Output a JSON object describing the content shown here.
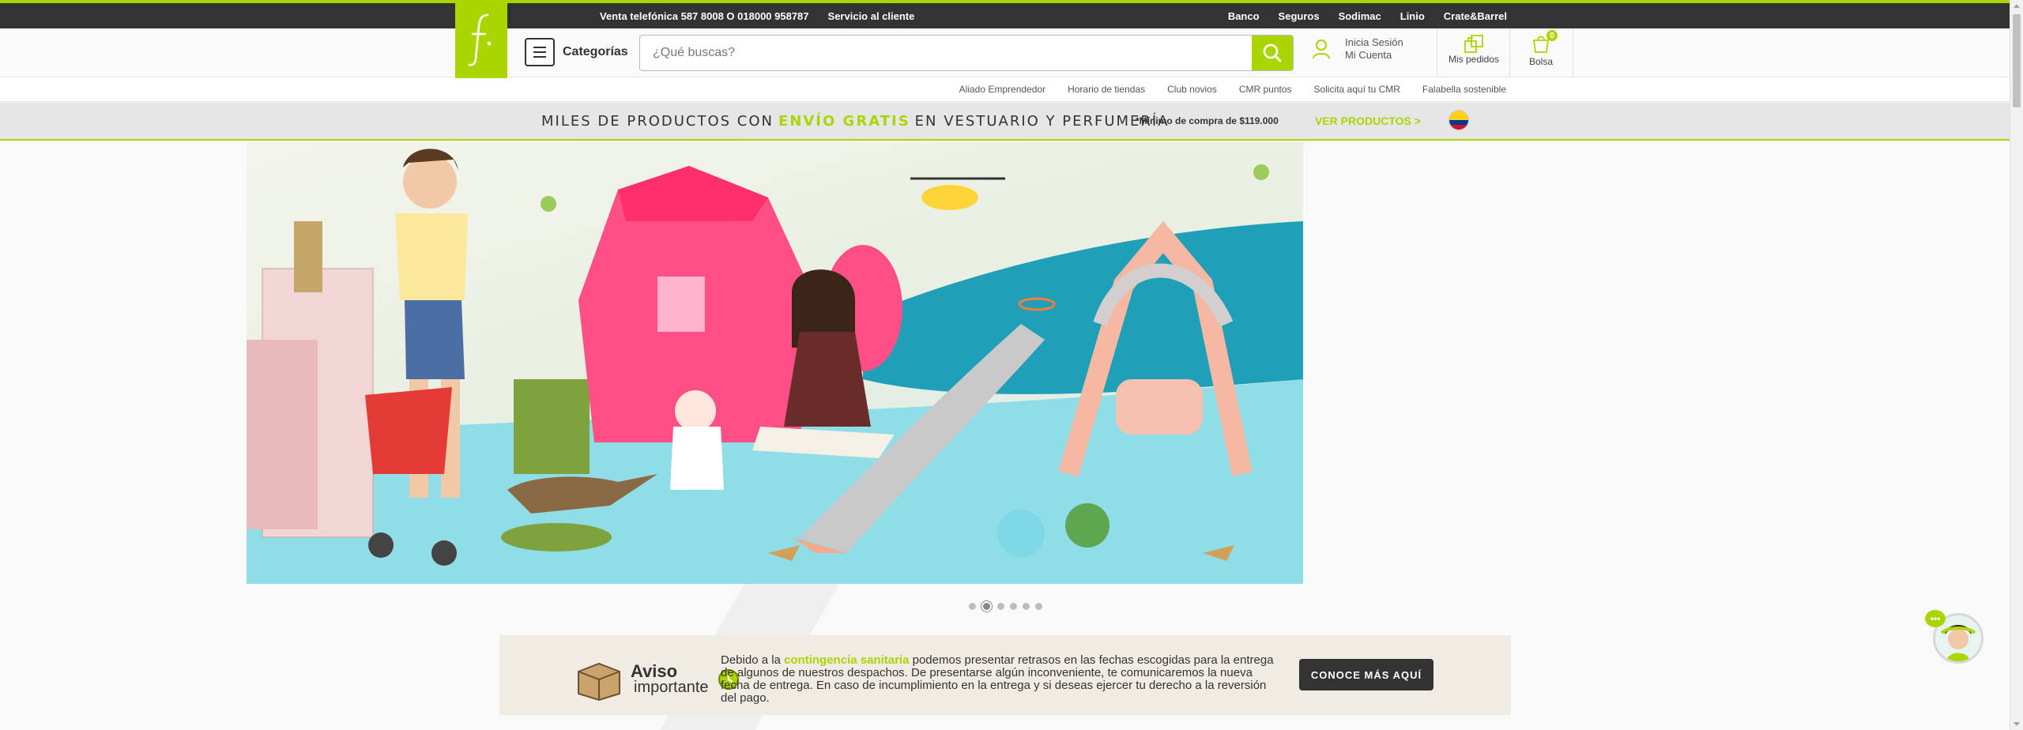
{
  "colors": {
    "brand": "#aad500",
    "dark": "#333333",
    "promo_bg": "#e6e6e6"
  },
  "topbar": {
    "phone": "Venta telefónica 587 8008 O 018000 958787",
    "customer_service": "Servicio al cliente",
    "links": [
      "Banco",
      "Seguros",
      "Sodimac",
      "Linio",
      "Crate&Barrel"
    ]
  },
  "logo": {
    "icon": "falabella-f-logo"
  },
  "header": {
    "categories_label": "Categorías",
    "search_placeholder": "¿Qué buscas?",
    "account_line1": "Inicia Sesión",
    "account_line2": "Mi Cuenta",
    "orders_label": "Mis pedidos",
    "bag_label": "Bolsa",
    "bag_count": "0"
  },
  "subnav": {
    "links": [
      "Aliado Emprendedor",
      "Horario de tiendas",
      "Club novios",
      "CMR puntos",
      "Solicita aquí tu CMR",
      "Falabella sostenible"
    ]
  },
  "promo": {
    "text_before": "MILES DE PRODUCTOS CON",
    "highlight": "ENVÍO GRATIS",
    "text_after": "EN VESTUARIO Y PERFUMERÍA",
    "minimum": "*Mínimo de compra de $119.000",
    "cta": "VER PRODUCTOS >"
  },
  "carousel": {
    "slides": 6,
    "active": 2
  },
  "notice": {
    "title1": "Aviso",
    "title2": "importante",
    "msg_before": "Debido a la",
    "msg_highlight": "contingencia sanitaria",
    "msg_after": "podemos presentar retrasos en las fechas escogidas para la entrega de algunos de nuestros despachos. De presentarse algún inconveniente, te comunicaremos la nueva fecha de entrega. En caso de incumplimiento en la entrega y si deseas ejercer tu derecho a la reversión del pago.",
    "button": "CONOCE MÁS AQUÍ"
  },
  "chat": {
    "bubble": "•••"
  }
}
